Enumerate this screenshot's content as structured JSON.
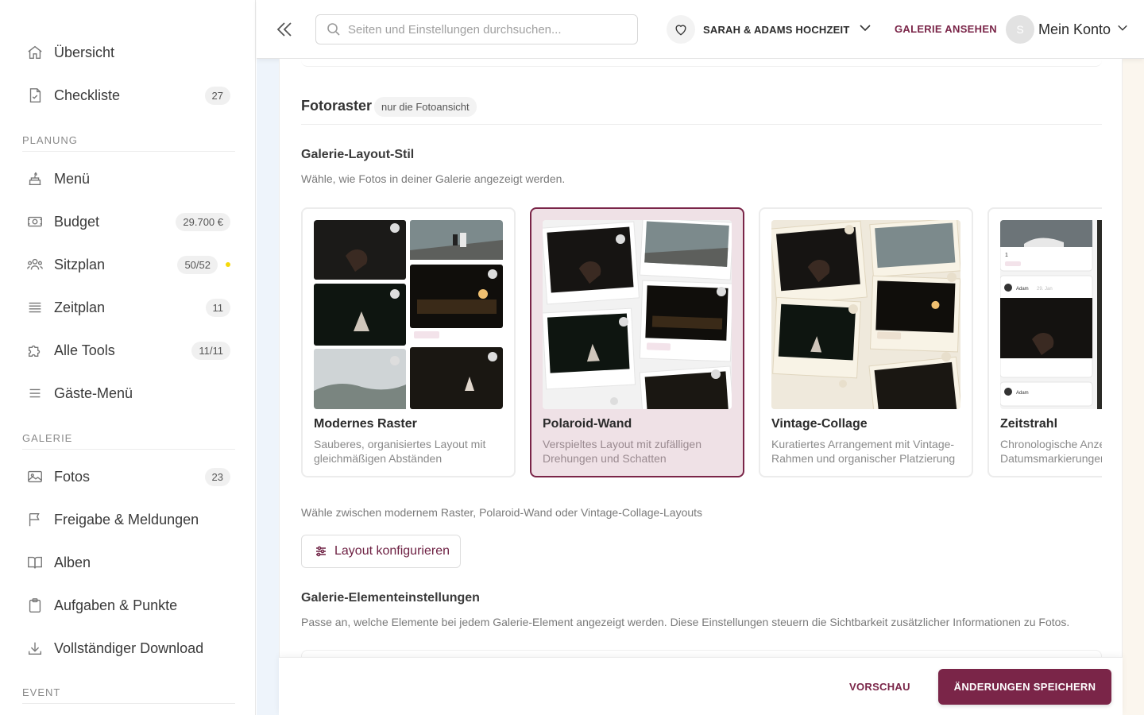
{
  "sidebar": {
    "items": [
      {
        "label": "Übersicht"
      },
      {
        "label": "Checkliste",
        "badge": "27"
      },
      {
        "label": "Menü"
      },
      {
        "label": "Budget",
        "badge": "29.700 €"
      },
      {
        "label": "Sitzplan",
        "badge": "50/52"
      },
      {
        "label": "Zeitplan",
        "badge": "11"
      },
      {
        "label": "Alle Tools",
        "badge": "11/11"
      },
      {
        "label": "Gäste-Menü"
      },
      {
        "label": "Fotos",
        "badge": "23"
      },
      {
        "label": "Freigabe & Meldungen"
      },
      {
        "label": "Alben"
      },
      {
        "label": "Aufgaben & Punkte"
      },
      {
        "label": "Vollständiger Download"
      }
    ],
    "sections": {
      "planning": "PLANUNG",
      "gallery": "GALERIE",
      "event": "EVENT"
    }
  },
  "topbar": {
    "search_placeholder": "Seiten und Einstellungen durchsuchen...",
    "event_name": "SARAH & ADAMS HOCHZEIT",
    "gallery_link": "GALERIE ANSEHEN",
    "avatar_initial": "S",
    "account_label": "Mein Konto"
  },
  "main": {
    "section_title": "Fotoraster",
    "section_pill": "nur die Fotoansicht",
    "layout_title": "Galerie-Layout-Stil",
    "layout_desc": "Wähle, wie Fotos in deiner Galerie angezeigt werden.",
    "layouts": [
      {
        "title": "Modernes Raster",
        "desc": "Sauberes, organisiertes Layout mit gleichmäßigen Abständen",
        "selected": false
      },
      {
        "title": "Polaroid-Wand",
        "desc": "Verspieltes Layout mit zufälligen Drehungen und Schatten",
        "selected": true
      },
      {
        "title": "Vintage-Collage",
        "desc": "Kuratiertes Arrangement mit Vintage-Rahmen und organischer Platzierung",
        "selected": false
      },
      {
        "title": "Zeitstrahl",
        "desc": "Chronologische Anzeige mit Datumsmarkierungen",
        "selected": false
      }
    ],
    "thumb_labels": {
      "tag": "Adam",
      "user": "Adam",
      "date": "29. Jan",
      "count": "1"
    },
    "layout_note": "Wähle zwischen modernem Raster, Polaroid-Wand oder Vintage-Collage-Layouts",
    "config_button": "Layout konfigurieren",
    "elements_title": "Galerie-Elementeinstellungen",
    "elements_desc": "Passe an, welche Elemente bei jedem Galerie-Element angezeigt werden. Diese Einstellungen steuern die Sichtbarkeit zusätzlicher Informationen zu Fotos."
  },
  "footer": {
    "preview": "VORSCHAU",
    "save": "ÄNDERUNGEN SPEICHERN"
  },
  "colors": {
    "accent": "#7a2548",
    "selected_bg": "#efe1e6",
    "status_dot": "#f5d90a"
  }
}
